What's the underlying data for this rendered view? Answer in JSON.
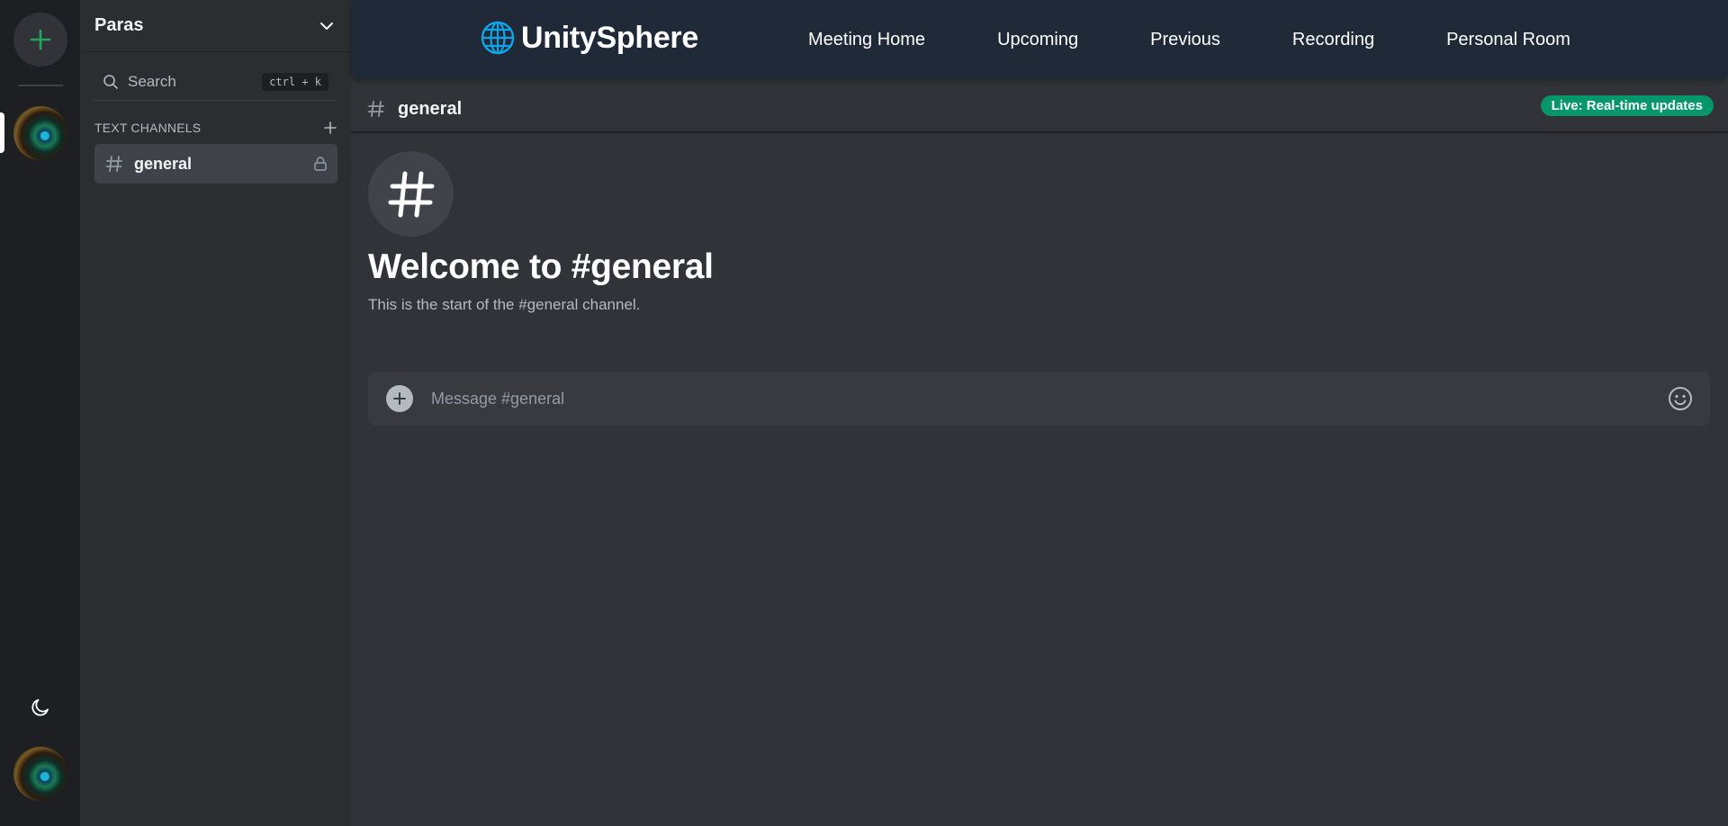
{
  "server": {
    "name": "Paras"
  },
  "search": {
    "label": "Search",
    "shortcut": "ctrl + k"
  },
  "channels": {
    "section_title": "TEXT CHANNELS",
    "items": [
      {
        "name": "general",
        "locked": true,
        "active": true
      }
    ]
  },
  "nav": {
    "brand": "UnitySphere",
    "links": [
      "Meeting Home",
      "Upcoming",
      "Previous",
      "Recording",
      "Personal Room"
    ]
  },
  "channel_header": {
    "name": "general",
    "live_badge": "Live: Real-time updates"
  },
  "welcome": {
    "title": "Welcome to #general",
    "subtitle": "This is the start of the #general channel."
  },
  "composer": {
    "placeholder": "Message #general"
  },
  "colors": {
    "accent_green": "#23a55a",
    "live_badge": "#059669",
    "brand_globe": "#0ea5e9",
    "nav_bg": "#1f2937"
  },
  "icons": {
    "rail_add": "plus-icon",
    "theme_toggle": "moon-icon",
    "search": "search-icon",
    "collapse": "chevron-down-icon",
    "add_channel": "plus-icon",
    "channel": "hash-icon",
    "lock": "lock-icon",
    "brand": "globe-icon",
    "attach": "plus-circle-icon",
    "emoji": "smile-icon"
  }
}
